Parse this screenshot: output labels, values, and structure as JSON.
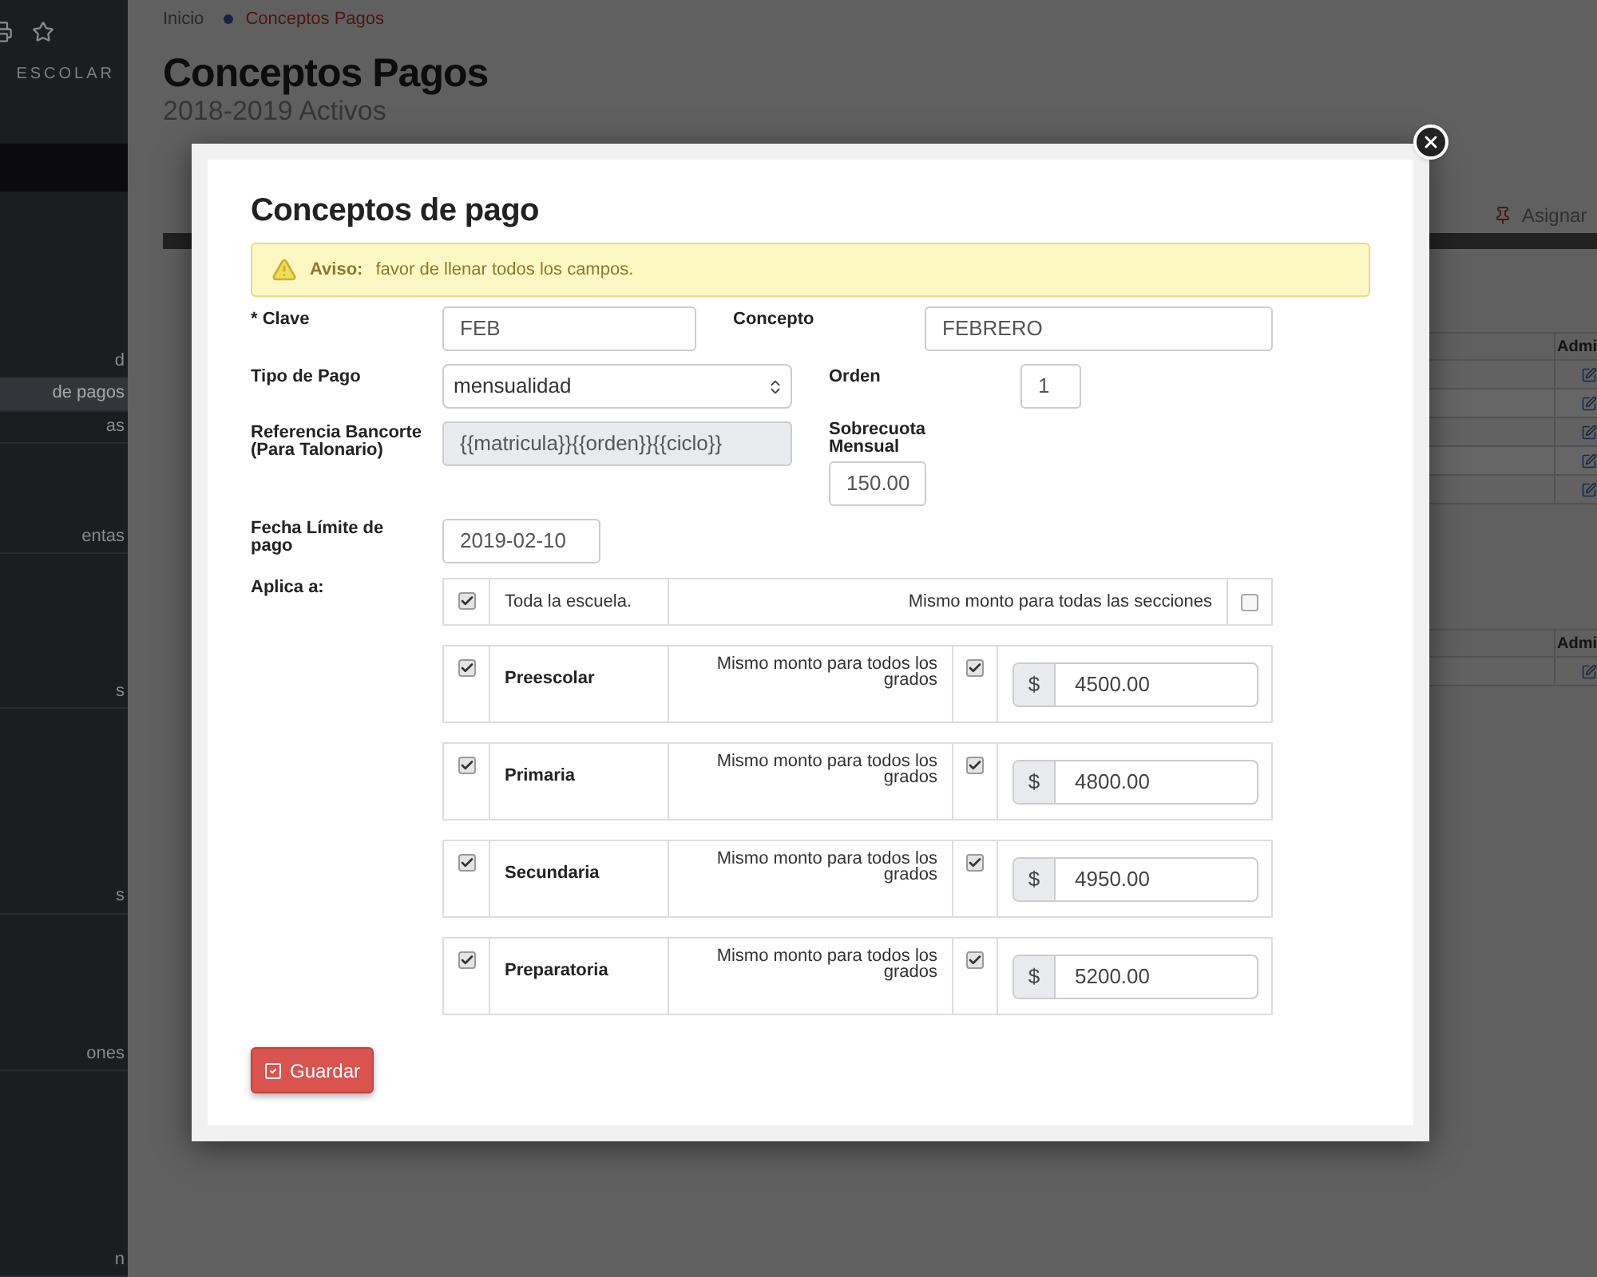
{
  "sidebar": {
    "brand": "ESCOLAR",
    "items": [
      {
        "label": "d",
        "selected": false
      },
      {
        "label": "de pagos",
        "selected": true
      },
      {
        "label": "as",
        "selected": false
      },
      {
        "label": "entas",
        "selected": false
      },
      {
        "label": "s",
        "selected": false
      },
      {
        "label": "s",
        "selected": false
      },
      {
        "label": "ones",
        "selected": false
      },
      {
        "label": "n",
        "selected": false
      }
    ]
  },
  "breadcrumb": [
    {
      "label": "Inicio"
    },
    {
      "label": "Conceptos Pagos"
    }
  ],
  "page": {
    "title": "Conceptos Pagos",
    "subtitle": "2018-2019 Activos",
    "toolbar_action": "Asignar"
  },
  "background_tables": [
    {
      "header": "Admi",
      "rows": [
        {
          "kind": "edit"
        },
        {
          "kind": "edit"
        },
        {
          "kind": "edit"
        },
        {
          "kind": "edit"
        },
        {
          "kind": "edit"
        }
      ]
    },
    {
      "header": "Admi",
      "rows": [
        {
          "kind": "edit"
        }
      ]
    }
  ],
  "modal": {
    "title": "Conceptos de pago",
    "alert": {
      "label": "Aviso:",
      "text": "favor de llenar todos los campos."
    },
    "fields": {
      "clave": {
        "label": "* Clave",
        "value": "FEB"
      },
      "concepto": {
        "label": "Concepto",
        "value": "FEBRERO"
      },
      "tipo": {
        "label": "Tipo de Pago",
        "value": "mensualidad"
      },
      "orden": {
        "label": "Orden",
        "value": "1"
      },
      "referencia": {
        "label": "Referencia Bancorte (Para Talonario)",
        "value": "{{matricula}}{{orden}}{{ciclo}}",
        "disabled": true
      },
      "sobrecuota": {
        "label": "Sobrecuota Mensual",
        "value": "150.00"
      },
      "fecha": {
        "label": "Fecha Límite de pago",
        "value": "2019-02-10"
      }
    },
    "aplica": {
      "label": "Aplica a:",
      "school": {
        "label": "Toda la escuela.",
        "checked": true,
        "same_label": "Mismo monto para todas las secciones",
        "same_checked": false
      },
      "sections": [
        {
          "name": "Preescolar",
          "checked": true,
          "same_label": "Mismo monto para todos los grados",
          "same_checked": true,
          "currency": "$",
          "amount": "4500.00"
        },
        {
          "name": "Primaria",
          "checked": true,
          "same_label": "Mismo monto para todos los grados",
          "same_checked": true,
          "currency": "$",
          "amount": "4800.00"
        },
        {
          "name": "Secundaria",
          "checked": true,
          "same_label": "Mismo monto para todos los grados",
          "same_checked": true,
          "currency": "$",
          "amount": "4950.00"
        },
        {
          "name": "Preparatoria",
          "checked": true,
          "same_label": "Mismo monto para todos los grados",
          "same_checked": true,
          "currency": "$",
          "amount": "5200.00"
        }
      ]
    },
    "save_button": "Guardar"
  }
}
